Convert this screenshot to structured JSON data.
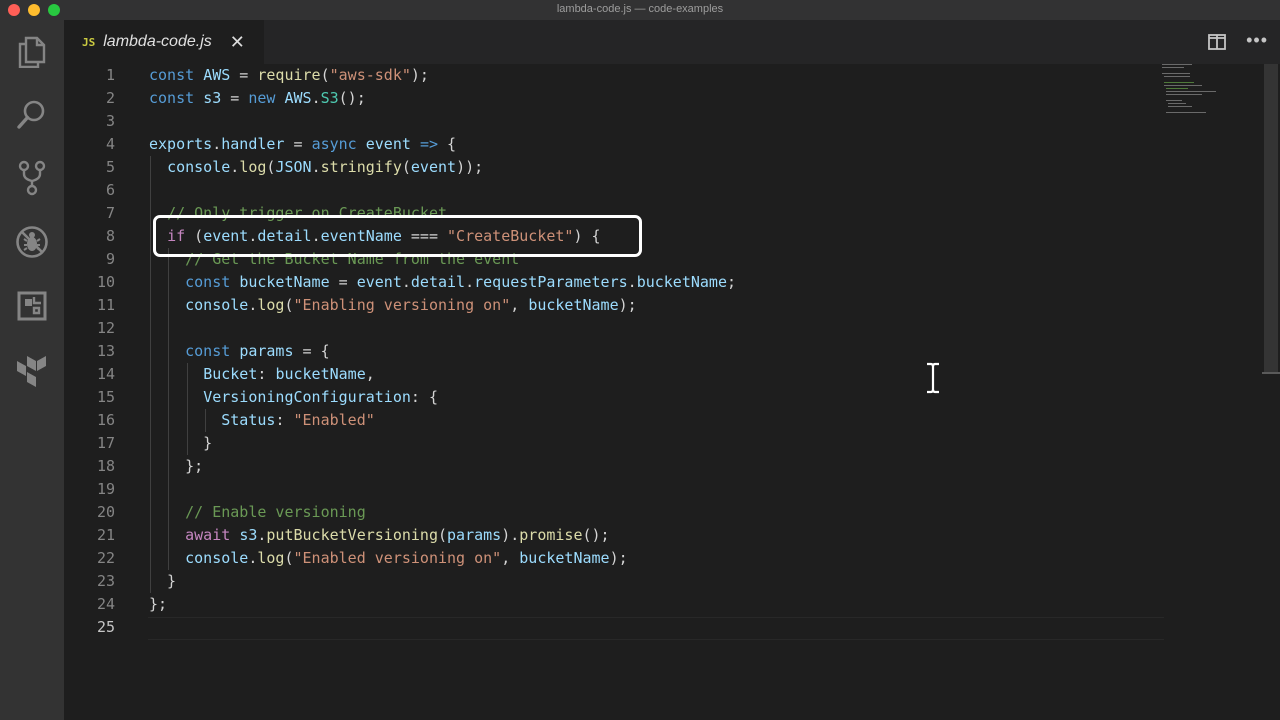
{
  "window": {
    "title": "lambda-code.js — code-examples"
  },
  "activity_bar": [
    {
      "name": "explorer-icon"
    },
    {
      "name": "search-icon"
    },
    {
      "name": "source-control-icon"
    },
    {
      "name": "debug-icon"
    },
    {
      "name": "extensions-icon"
    },
    {
      "name": "terraform-icon"
    }
  ],
  "tab": {
    "badge": "JS",
    "filename": "lambda-code.js",
    "close": "✕"
  },
  "editor": {
    "current_line": 25,
    "lines": [
      {
        "n": "1",
        "tokens": [
          [
            "kw",
            "const"
          ],
          [
            "pl",
            " "
          ],
          [
            "var",
            "AWS"
          ],
          [
            "pl",
            " = "
          ],
          [
            "fn",
            "require"
          ],
          [
            "pl",
            "("
          ],
          [
            "str",
            "\"aws-sdk\""
          ],
          [
            "pl",
            ");"
          ]
        ]
      },
      {
        "n": "2",
        "tokens": [
          [
            "kw",
            "const"
          ],
          [
            "pl",
            " "
          ],
          [
            "var",
            "s3"
          ],
          [
            "pl",
            " = "
          ],
          [
            "kw",
            "new"
          ],
          [
            "pl",
            " "
          ],
          [
            "var",
            "AWS"
          ],
          [
            "pl",
            "."
          ],
          [
            "cls",
            "S3"
          ],
          [
            "pl",
            "();"
          ]
        ]
      },
      {
        "n": "3",
        "tokens": []
      },
      {
        "n": "4",
        "tokens": [
          [
            "var",
            "exports"
          ],
          [
            "pl",
            "."
          ],
          [
            "var",
            "handler"
          ],
          [
            "pl",
            " = "
          ],
          [
            "kw",
            "async"
          ],
          [
            "pl",
            " "
          ],
          [
            "var",
            "event"
          ],
          [
            "pl",
            " "
          ],
          [
            "kw",
            "=>"
          ],
          [
            "pl",
            " {"
          ]
        ]
      },
      {
        "n": "5",
        "tokens": [
          [
            "pl",
            "  "
          ],
          [
            "var",
            "console"
          ],
          [
            "pl",
            "."
          ],
          [
            "fn",
            "log"
          ],
          [
            "pl",
            "("
          ],
          [
            "var",
            "JSON"
          ],
          [
            "pl",
            "."
          ],
          [
            "fn",
            "stringify"
          ],
          [
            "pl",
            "("
          ],
          [
            "var",
            "event"
          ],
          [
            "pl",
            "));"
          ]
        ]
      },
      {
        "n": "6",
        "tokens": []
      },
      {
        "n": "7",
        "tokens": [
          [
            "pl",
            "  "
          ],
          [
            "cm",
            "// Only trigger on CreateBucket"
          ]
        ]
      },
      {
        "n": "8",
        "tokens": [
          [
            "pl",
            "  "
          ],
          [
            "ctl",
            "if"
          ],
          [
            "pl",
            " ("
          ],
          [
            "var",
            "event"
          ],
          [
            "pl",
            "."
          ],
          [
            "var",
            "detail"
          ],
          [
            "pl",
            "."
          ],
          [
            "var",
            "eventName"
          ],
          [
            "pl",
            " === "
          ],
          [
            "str",
            "\"CreateBucket\""
          ],
          [
            "pl",
            ") {"
          ]
        ]
      },
      {
        "n": "9",
        "tokens": [
          [
            "pl",
            "    "
          ],
          [
            "cm",
            "// Get the Bucket Name from the event"
          ]
        ]
      },
      {
        "n": "10",
        "tokens": [
          [
            "pl",
            "    "
          ],
          [
            "kw",
            "const"
          ],
          [
            "pl",
            " "
          ],
          [
            "var",
            "bucketName"
          ],
          [
            "pl",
            " = "
          ],
          [
            "var",
            "event"
          ],
          [
            "pl",
            "."
          ],
          [
            "var",
            "detail"
          ],
          [
            "pl",
            "."
          ],
          [
            "var",
            "requestParameters"
          ],
          [
            "pl",
            "."
          ],
          [
            "var",
            "bucketName"
          ],
          [
            "pl",
            ";"
          ]
        ]
      },
      {
        "n": "11",
        "tokens": [
          [
            "pl",
            "    "
          ],
          [
            "var",
            "console"
          ],
          [
            "pl",
            "."
          ],
          [
            "fn",
            "log"
          ],
          [
            "pl",
            "("
          ],
          [
            "str",
            "\"Enabling versioning on\""
          ],
          [
            "pl",
            ", "
          ],
          [
            "var",
            "bucketName"
          ],
          [
            "pl",
            ");"
          ]
        ]
      },
      {
        "n": "12",
        "tokens": []
      },
      {
        "n": "13",
        "tokens": [
          [
            "pl",
            "    "
          ],
          [
            "kw",
            "const"
          ],
          [
            "pl",
            " "
          ],
          [
            "var",
            "params"
          ],
          [
            "pl",
            " = {"
          ]
        ]
      },
      {
        "n": "14",
        "tokens": [
          [
            "pl",
            "      "
          ],
          [
            "var",
            "Bucket"
          ],
          [
            "pl",
            ": "
          ],
          [
            "var",
            "bucketName"
          ],
          [
            "pl",
            ","
          ]
        ]
      },
      {
        "n": "15",
        "tokens": [
          [
            "pl",
            "      "
          ],
          [
            "var",
            "VersioningConfiguration"
          ],
          [
            "pl",
            ": {"
          ]
        ]
      },
      {
        "n": "16",
        "tokens": [
          [
            "pl",
            "        "
          ],
          [
            "var",
            "Status"
          ],
          [
            "pl",
            ": "
          ],
          [
            "str",
            "\"Enabled\""
          ]
        ]
      },
      {
        "n": "17",
        "tokens": [
          [
            "pl",
            "      }"
          ]
        ]
      },
      {
        "n": "18",
        "tokens": [
          [
            "pl",
            "    };"
          ]
        ]
      },
      {
        "n": "19",
        "tokens": []
      },
      {
        "n": "20",
        "tokens": [
          [
            "pl",
            "    "
          ],
          [
            "cm",
            "// Enable versioning"
          ]
        ]
      },
      {
        "n": "21",
        "tokens": [
          [
            "pl",
            "    "
          ],
          [
            "ctl",
            "await"
          ],
          [
            "pl",
            " "
          ],
          [
            "var",
            "s3"
          ],
          [
            "pl",
            "."
          ],
          [
            "fn",
            "putBucketVersioning"
          ],
          [
            "pl",
            "("
          ],
          [
            "var",
            "params"
          ],
          [
            "pl",
            ")."
          ],
          [
            "fn",
            "promise"
          ],
          [
            "pl",
            "();"
          ]
        ]
      },
      {
        "n": "22",
        "tokens": [
          [
            "pl",
            "    "
          ],
          [
            "var",
            "console"
          ],
          [
            "pl",
            "."
          ],
          [
            "fn",
            "log"
          ],
          [
            "pl",
            "("
          ],
          [
            "str",
            "\"Enabled versioning on\""
          ],
          [
            "pl",
            ", "
          ],
          [
            "var",
            "bucketName"
          ],
          [
            "pl",
            ");"
          ]
        ]
      },
      {
        "n": "23",
        "tokens": [
          [
            "pl",
            "  }"
          ]
        ]
      },
      {
        "n": "24",
        "tokens": [
          [
            "pl",
            "};"
          ]
        ]
      },
      {
        "n": "25",
        "tokens": []
      }
    ]
  },
  "colors": {
    "keyword": "#569cd6",
    "control": "#c586c0",
    "function": "#dcdcaa",
    "variable": "#9cdcfe",
    "string": "#ce9178",
    "class": "#4ec9b0",
    "comment": "#6a9955",
    "highlight_box": "#ffffff"
  }
}
